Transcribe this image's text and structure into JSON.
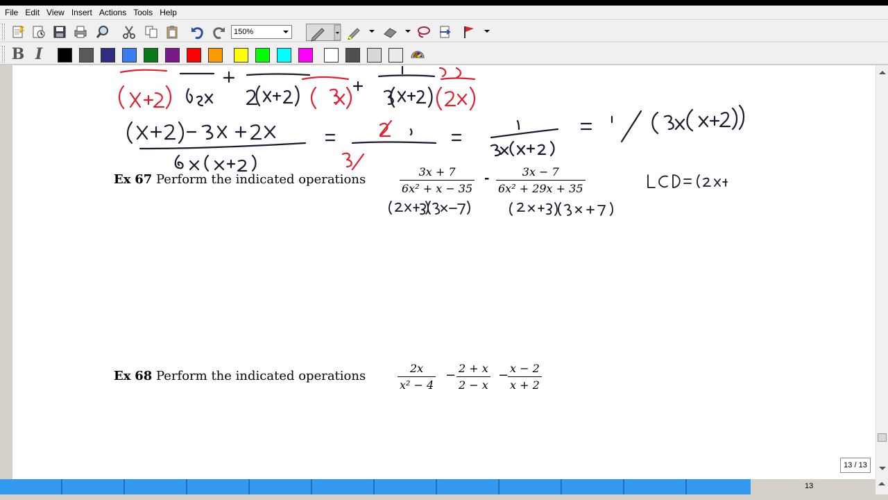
{
  "menu": [
    "File",
    "Edit",
    "View",
    "Insert",
    "Actions",
    "Tools",
    "Help"
  ],
  "toolbar": {
    "zoom_value": "150%",
    "icons": [
      "new-page-icon",
      "screen-capture-icon",
      "save-icon",
      "print-icon",
      "find-icon",
      "cut-icon",
      "copy-icon",
      "paste-icon",
      "undo-icon",
      "redo-icon",
      "pen-icon",
      "highlighter-icon",
      "eraser-icon",
      "lasso-icon",
      "insert-space-icon",
      "flag-icon"
    ]
  },
  "format": {
    "bold_label": "B",
    "italic_label": "I",
    "colors": [
      "#000000",
      "#595959",
      "#2e2e80",
      "#3a7df0",
      "#0a7a1a",
      "#7a1a8a",
      "#ff0000",
      "#ff9a00",
      "#ffff00",
      "#00ff00",
      "#00ffff",
      "#ff00ff",
      "#ffffff",
      "#505050",
      "#d8d8d8",
      "#ebebeb"
    ],
    "palette_icon": "color-palette-icon"
  },
  "document": {
    "ex67": {
      "label": "Ex",
      "number": "67",
      "text": "Perform the indicated operations",
      "frac1_num": "3x + 7",
      "frac1_den": "6x² + x − 35",
      "op": "-",
      "frac2_num": "3x − 7",
      "frac2_den": "6x² + 29x + 35"
    },
    "ex68": {
      "label": "Ex",
      "number": "68",
      "text": "Perform the indicated operations",
      "frac1_num": "2x",
      "frac1_den": "x² − 4",
      "op1": "−",
      "frac2_num": "2 + x",
      "frac2_den": "2 − x",
      "op2": "−",
      "frac3_num": "x − 2",
      "frac3_den": "x + 2"
    }
  },
  "page_indicator": "13 / 13",
  "page_number": "13"
}
